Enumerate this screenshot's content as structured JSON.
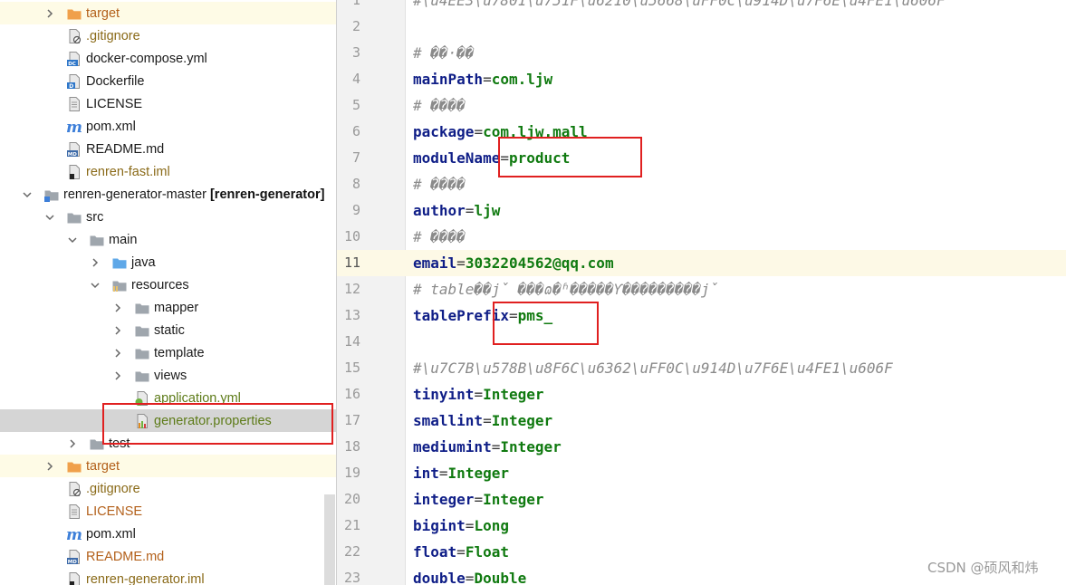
{
  "project_tree": {
    "items": [
      {
        "label": "target",
        "icon": "folder-orange-icon",
        "color": "orange",
        "expanded": false,
        "highlight": "yellow"
      },
      {
        "label": ".gitignore",
        "icon": "gitignore-file-icon",
        "color": "olive"
      },
      {
        "label": "docker-compose.yml",
        "icon": "docker-compose-file-icon",
        "color": "default"
      },
      {
        "label": "Dockerfile",
        "icon": "dockerfile-icon",
        "color": "default"
      },
      {
        "label": "LICENSE",
        "icon": "text-file-icon",
        "color": "default"
      },
      {
        "label": "pom.xml",
        "icon": "maven-file-icon",
        "color": "default"
      },
      {
        "label": "README.md",
        "icon": "markdown-file-icon",
        "color": "default"
      },
      {
        "label": "renren-fast.iml",
        "icon": "iml-file-icon",
        "color": "olive"
      },
      {
        "label": "renren-generator-master",
        "module": "[renren-generator]",
        "icon": "module-folder-icon",
        "color": "default",
        "expanded": true
      },
      {
        "label": "src",
        "icon": "folder-icon",
        "color": "default",
        "expanded": true
      },
      {
        "label": "main",
        "icon": "folder-icon",
        "color": "default",
        "expanded": true
      },
      {
        "label": "java",
        "icon": "source-folder-icon",
        "color": "default",
        "expanded": false
      },
      {
        "label": "resources",
        "icon": "resources-folder-icon",
        "color": "default",
        "expanded": true
      },
      {
        "label": "mapper",
        "icon": "folder-icon",
        "color": "default",
        "expanded": false
      },
      {
        "label": "static",
        "icon": "folder-icon",
        "color": "default",
        "expanded": false
      },
      {
        "label": "template",
        "icon": "folder-icon",
        "color": "default",
        "expanded": false
      },
      {
        "label": "views",
        "icon": "folder-icon",
        "color": "default",
        "expanded": false
      },
      {
        "label": "application.yml",
        "icon": "spring-yml-icon",
        "color": "green"
      },
      {
        "label": "generator.properties",
        "icon": "properties-file-icon",
        "color": "green",
        "highlight": "selected"
      },
      {
        "label": "test",
        "icon": "folder-icon",
        "color": "default",
        "expanded": false
      },
      {
        "label": "target",
        "icon": "folder-orange-icon",
        "color": "orange",
        "expanded": false,
        "highlight": "yellow"
      },
      {
        "label": ".gitignore",
        "icon": "gitignore-file-icon",
        "color": "olive"
      },
      {
        "label": "LICENSE",
        "icon": "text-file-icon",
        "color": "orange"
      },
      {
        "label": "pom.xml",
        "icon": "maven-file-icon",
        "color": "default"
      },
      {
        "label": "README.md",
        "icon": "markdown-file-icon",
        "color": "orange"
      },
      {
        "label": "renren-generator.iml",
        "icon": "iml-file-icon",
        "color": "olive"
      }
    ]
  },
  "editor": {
    "current_line": 11,
    "lines": [
      {
        "n": "1",
        "type": "comment",
        "text": "#\\u4EE3\\u7801\\u751F\\u6210\\u5668\\uFF0C\\u914D\\u7F6E\\u4FE1\\u606F"
      },
      {
        "n": "2",
        "type": "empty",
        "text": ""
      },
      {
        "n": "3",
        "type": "comment",
        "text": "# ��·��"
      },
      {
        "n": "4",
        "type": "kv",
        "key": "mainPath",
        "value": "com.ljw"
      },
      {
        "n": "5",
        "type": "comment",
        "text": "# ����"
      },
      {
        "n": "6",
        "type": "kv",
        "key": "package",
        "value": "com.ljw.mall"
      },
      {
        "n": "7",
        "type": "kv",
        "key": "moduleName",
        "value": "product"
      },
      {
        "n": "8",
        "type": "comment",
        "text": "# ����"
      },
      {
        "n": "9",
        "type": "kv",
        "key": "author",
        "value": "ljw"
      },
      {
        "n": "10",
        "type": "comment",
        "text": "# ����"
      },
      {
        "n": "11",
        "type": "kv",
        "key": "email",
        "value": "3032204562@qq.com"
      },
      {
        "n": "12",
        "type": "comment",
        "text": "# table��ǰ׺ ���ɷ�ʱ�����Ƴ���������ǰ׺"
      },
      {
        "n": "13",
        "type": "kv",
        "key": "tablePrefix",
        "value": "pms_"
      },
      {
        "n": "14",
        "type": "empty",
        "text": ""
      },
      {
        "n": "15",
        "type": "comment",
        "text": "#\\u7C7B\\u578B\\u8F6C\\u6362\\uFF0C\\u914D\\u7F6E\\u4FE1\\u606F"
      },
      {
        "n": "16",
        "type": "kv",
        "key": "tinyint",
        "value": "Integer"
      },
      {
        "n": "17",
        "type": "kv",
        "key": "smallint",
        "value": "Integer"
      },
      {
        "n": "18",
        "type": "kv",
        "key": "mediumint",
        "value": "Integer"
      },
      {
        "n": "19",
        "type": "kv",
        "key": "int",
        "value": "Integer"
      },
      {
        "n": "20",
        "type": "kv",
        "key": "integer",
        "value": "Integer"
      },
      {
        "n": "21",
        "type": "kv",
        "key": "bigint",
        "value": "Long"
      },
      {
        "n": "22",
        "type": "kv",
        "key": "float",
        "value": "Float"
      },
      {
        "n": "23",
        "type": "kv",
        "key": "double",
        "value": "Double"
      }
    ]
  },
  "watermark": "CSDN @硕风和炜",
  "colors": {
    "keyword": "#0f1e87",
    "value": "#107a10",
    "comment": "#8a8a8a",
    "annotation": "#e02020"
  }
}
